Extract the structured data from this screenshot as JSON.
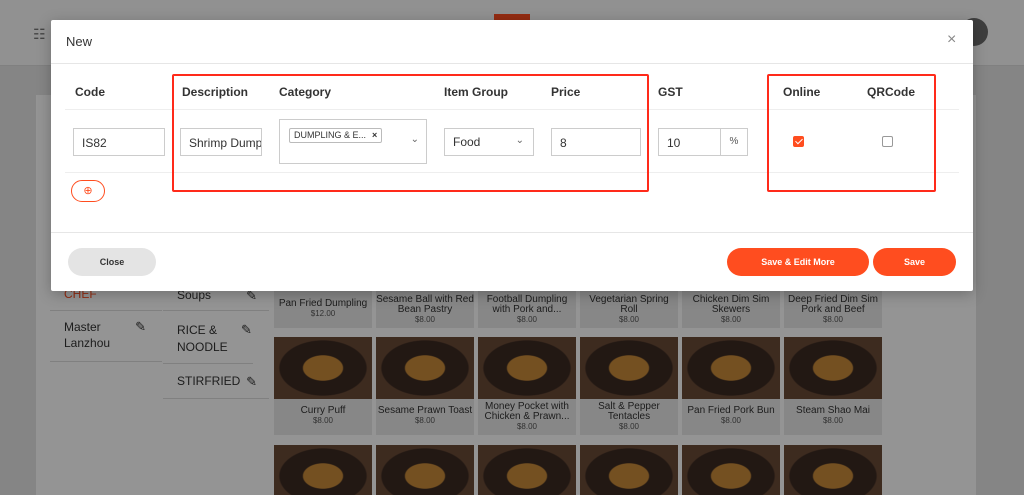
{
  "modal": {
    "title": "New",
    "close_icon": "×",
    "columns": {
      "code": "Code",
      "description": "Description",
      "category": "Category",
      "item_group": "Item Group",
      "price": "Price",
      "gst": "GST",
      "online": "Online",
      "qrcode": "QRCode"
    },
    "row": {
      "code": "IS82",
      "description": "Shrimp Dumpling",
      "category_chip": "DUMPLING & E...",
      "category_chip_remove": "×",
      "item_group": "Food",
      "price": "8",
      "gst": "10",
      "gst_suffix": "%",
      "online": true,
      "qrcode": false
    },
    "add_row_icon": "⊕",
    "buttons": {
      "close": "Close",
      "save_edit_more": "Save & Edit More",
      "save": "Save"
    }
  },
  "background": {
    "menu_icon": "☷",
    "sidebar": {
      "active_label": "CHEF",
      "items": [
        {
          "label": "Master Lanzhou"
        }
      ]
    },
    "categories": [
      {
        "label": "Soups"
      },
      {
        "label": "RICE & NOODLE"
      },
      {
        "label": "STIRFRIED"
      }
    ],
    "edit_icon": "✎",
    "menu_items": [
      {
        "name": "Pan Fried Dumpling",
        "price": "$12.00"
      },
      {
        "name": "Sesame Ball with Red Bean Pastry",
        "price": "$8.00"
      },
      {
        "name": "Football Dumpling with Pork and...",
        "price": "$8.00"
      },
      {
        "name": "Vegetarian Spring Roll",
        "price": "$8.00"
      },
      {
        "name": "Chicken Dim Sim Skewers",
        "price": "$8.00"
      },
      {
        "name": "Deep Fried Dim Sim Pork and Beef",
        "price": "$8.00"
      },
      {
        "name": "Curry Puff",
        "price": "$8.00"
      },
      {
        "name": "Sesame Prawn Toast",
        "price": "$8.00"
      },
      {
        "name": "Money Pocket with Chicken & Prawn...",
        "price": "$8.00"
      },
      {
        "name": "Salt & Pepper Tentacles",
        "price": "$8.00"
      },
      {
        "name": "Pan Fried Pork Bun",
        "price": "$8.00"
      },
      {
        "name": "Steam Shao Mai",
        "price": "$8.00"
      }
    ]
  },
  "colors": {
    "accent": "#ff4d1f",
    "highlight_box": "#ff2a1a"
  }
}
